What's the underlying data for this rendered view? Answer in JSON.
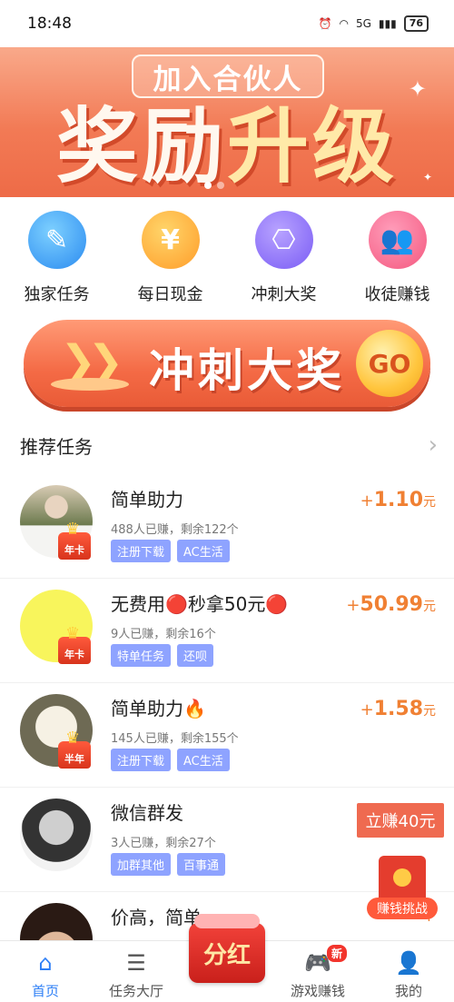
{
  "status_bar": {
    "time": "18:48",
    "signal": "5G",
    "battery": "76"
  },
  "banner": {
    "pill_text": "加入合伙人",
    "headline_white": "奖励",
    "headline_gold": "升级"
  },
  "quick_entries": [
    {
      "label": "独家任务",
      "icon": "edit-note-icon",
      "symbol": "✎"
    },
    {
      "label": "每日现金",
      "icon": "yen-coin-icon",
      "symbol": "¥"
    },
    {
      "label": "冲刺大奖",
      "icon": "hierarchy-icon",
      "symbol": "⎔"
    },
    {
      "label": "收徒赚钱",
      "icon": "people-icon",
      "symbol": "👥"
    }
  ],
  "big_button": {
    "text": "冲刺大奖",
    "go": "GO"
  },
  "section": {
    "title": "推荐任务"
  },
  "tasks": [
    {
      "name": "简单助力",
      "meta": "488人已赚，剩余122个",
      "tags": [
        "注册下载",
        "AC生活"
      ],
      "badge": "年卡",
      "reward_prefix": "+",
      "reward": "1.10",
      "reward_unit": "元"
    },
    {
      "name": "无费用🔴秒拿50元🔴",
      "meta": "9人已赚，剩余16个",
      "tags": [
        "特单任务",
        "还呗"
      ],
      "badge": "年卡",
      "reward_prefix": "+",
      "reward": "50.99",
      "reward_unit": "元"
    },
    {
      "name": "简单助力🔥",
      "meta": "145人已赚，剩余155个",
      "tags": [
        "注册下载",
        "AC生活"
      ],
      "badge": "半年",
      "reward_prefix": "+",
      "reward": "1.58",
      "reward_unit": "元"
    },
    {
      "name": "微信群发",
      "meta": "3人已赚，剩余27个",
      "tags": [
        "加群其他",
        "百事通"
      ],
      "badge": "",
      "reward_prefix": "+",
      "reward": "",
      "reward_unit": ""
    },
    {
      "name": "价高，简单",
      "meta": "",
      "tags": [],
      "badge": "",
      "reward_prefix": "+",
      "reward": "",
      "reward_unit": ""
    }
  ],
  "floating": {
    "earn_now": "立赚40元",
    "challenge": "赚钱挑战"
  },
  "bottom_nav": {
    "home": "首页",
    "tasks_hall": "任务大厅",
    "center": "分红",
    "games": "游戏赚钱",
    "games_badge": "新",
    "mine": "我的"
  }
}
